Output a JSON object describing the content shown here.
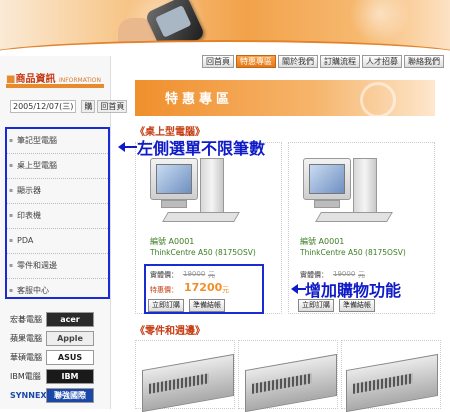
{
  "nav": {
    "items": [
      "回首頁",
      "特惠專區",
      "關於我們",
      "訂購流程",
      "人才招募",
      "聯絡我們"
    ],
    "active_index": 1
  },
  "sidebar": {
    "title": "商品資訊",
    "title_en": "INFORMATION",
    "date": "2005/12/07(三)",
    "cart_label": "購",
    "login_label": "回首頁",
    "menu": [
      "筆記型電腦",
      "桌上型電腦",
      "顯示器",
      "印表機",
      "PDA",
      "零件和週邊",
      "客服中心"
    ],
    "brands": [
      {
        "label": "宏碁電腦",
        "logo": "acer",
        "color": "#2a2a2a"
      },
      {
        "label": "蘋果電腦",
        "logo": "Apple",
        "color": "#555555"
      },
      {
        "label": "華碩電腦",
        "logo": "ASUS",
        "color": "#2a2a2a"
      },
      {
        "label": "IBM電腦",
        "logo": "IBM",
        "color": "#1a1a1a"
      },
      {
        "label": "SYNNEX",
        "logo": "聯強國際",
        "color": "#1b48a8"
      }
    ]
  },
  "banner": {
    "title": "特惠專區"
  },
  "section1": {
    "title": "《桌上型電腦》"
  },
  "section2": {
    "title": "《零件和週邊》"
  },
  "products": [
    {
      "code": "編號 A0001",
      "name": "ThinkCentre A50 (8175OSV)",
      "list_label": "實體價：",
      "list_price": "19000",
      "list_unit": "元",
      "sale_label": "特惠價：",
      "sale_price": "17200",
      "sale_unit": "元",
      "buy_label": "立即訂購",
      "checkout_label": "準備結帳"
    },
    {
      "code": "編號 A0001",
      "name": "ThinkCentre A50 (8175OSV)",
      "list_label": "實體價：",
      "list_price": "19000",
      "list_unit": "元",
      "buy_label": "立即訂購",
      "checkout_label": "準備結帳"
    }
  ],
  "annotations": {
    "left_menu": "左側選單不限筆數",
    "add_cart": "增加購物功能"
  },
  "colors": {
    "accent": "#f08f2c",
    "highlight": "#1a2bd4",
    "title": "#c63b12"
  }
}
